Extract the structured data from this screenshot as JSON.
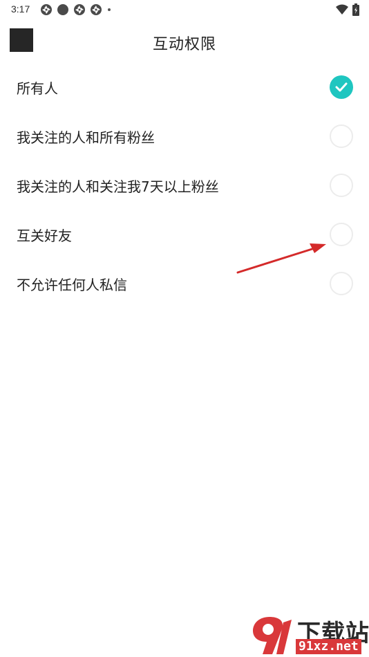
{
  "status_bar": {
    "time": "3:17",
    "icons": [
      "app-icon",
      "record-dot-icon",
      "app-icon",
      "app-icon",
      "dot-icon"
    ],
    "right_icons": [
      "wifi-icon",
      "battery-icon"
    ]
  },
  "header": {
    "title": "互动权限"
  },
  "options": [
    {
      "label": "所有人",
      "checked": true
    },
    {
      "label": "我关注的人和所有粉丝",
      "checked": false
    },
    {
      "label": "我关注的人和关注我7天以上粉丝",
      "checked": false
    },
    {
      "label": "互关好友",
      "checked": false
    },
    {
      "label": "不允许任何人私信",
      "checked": false
    }
  ],
  "colors": {
    "accent": "#1fc6c0",
    "arrow": "#d42a2a",
    "radio_border": "#ececec",
    "watermark_red": "#d9383a"
  },
  "watermark": {
    "main_text": "下载站",
    "site_text": "91xz.net"
  }
}
